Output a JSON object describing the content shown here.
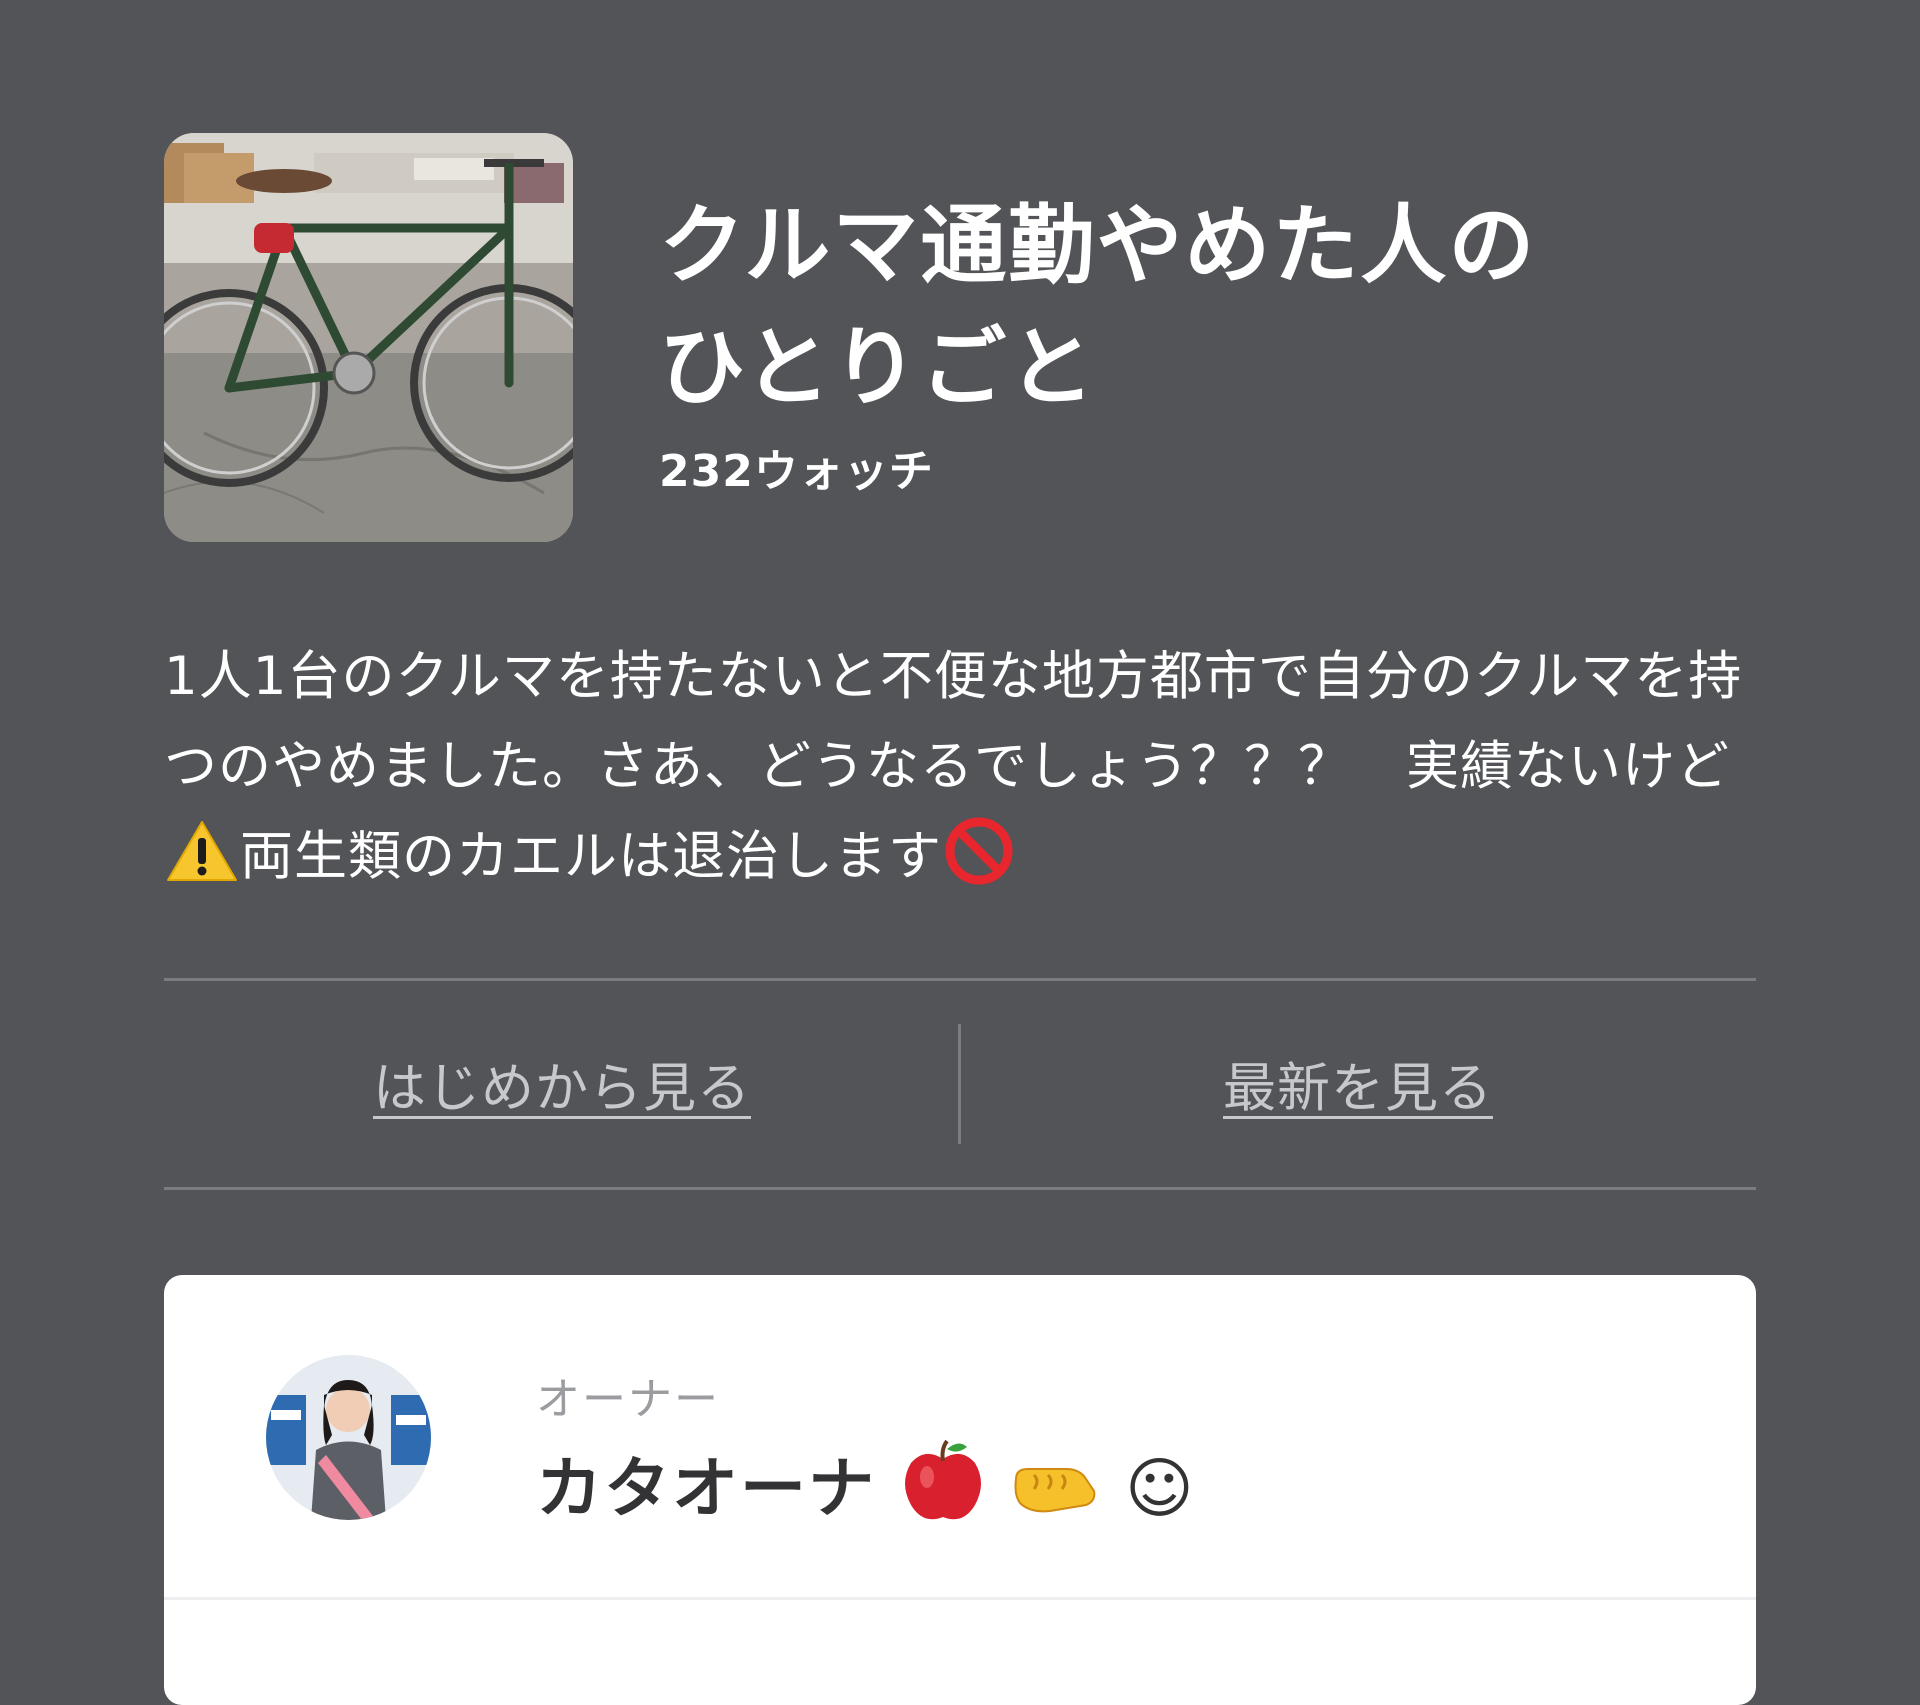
{
  "channel": {
    "title_line1": "クルマ通勤やめた人の",
    "title_line2": "ひとりごと",
    "watch_count": "232ウォッチ",
    "thumbnail_icon": "bicycle-photo",
    "description_part1": "1人1台のクルマを持たないと不便な地方都市で自分のクルマを持つのやめました。さあ、どうなるでしょう？？？　実績ないけど ",
    "description_part2": "両生類のカエルは退治します"
  },
  "nav": {
    "from_start_label": "はじめから見る",
    "latest_label": "最新を見る"
  },
  "owner": {
    "label": "オーナー",
    "name": "カタオーナ",
    "avatar_icon": "person-photo",
    "smile_glyph": "☺"
  },
  "colors": {
    "background": "#525458",
    "card": "#ffffff",
    "link": "#c6c8cc",
    "divider": "#7b7d82"
  }
}
